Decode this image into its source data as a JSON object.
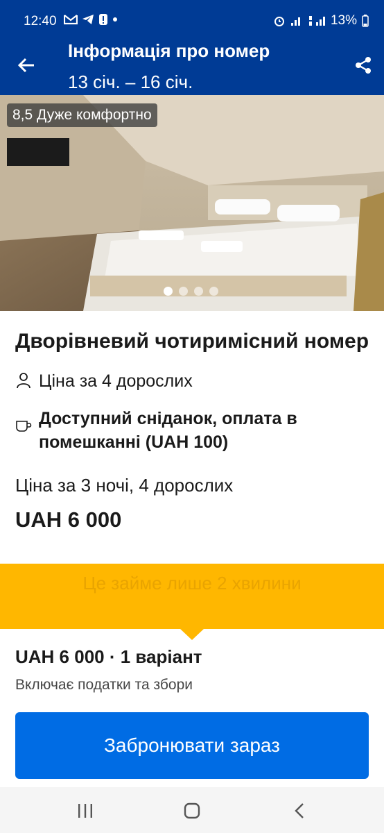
{
  "status_bar": {
    "time": "12:40",
    "battery_percent": "13%"
  },
  "header": {
    "title": "Інформація про номер",
    "dates": "13 січ. – 16 січ."
  },
  "photo": {
    "rating_badge": "8,5 Дуже комфортно",
    "carousel": {
      "current": 1,
      "total": 4
    }
  },
  "room": {
    "name": "Дворівневий чотиримісний номер",
    "occupancy": "Ціна за 4 дорослих",
    "breakfast": "Доступний сніданок, оплата в помешканні (UAH 100)",
    "price_label": "Ціна за 3 ночі, 4 дорослих",
    "price": "UAH 6 000"
  },
  "banner": {
    "text": "Це займе лише 2 хвилини"
  },
  "footer": {
    "total": "UAH 6 000 · 1 варіант",
    "taxes": "Включає податки та збори",
    "book_button": "Забронювати зараз"
  },
  "colors": {
    "brand_blue": "#003b95",
    "button_blue": "#006ce4",
    "banner_yellow": "#ffb700"
  },
  "icons": [
    "back-arrow-icon",
    "share-icon",
    "person-icon",
    "cup-icon",
    "recents-icon",
    "home-icon",
    "back-nav-icon"
  ]
}
